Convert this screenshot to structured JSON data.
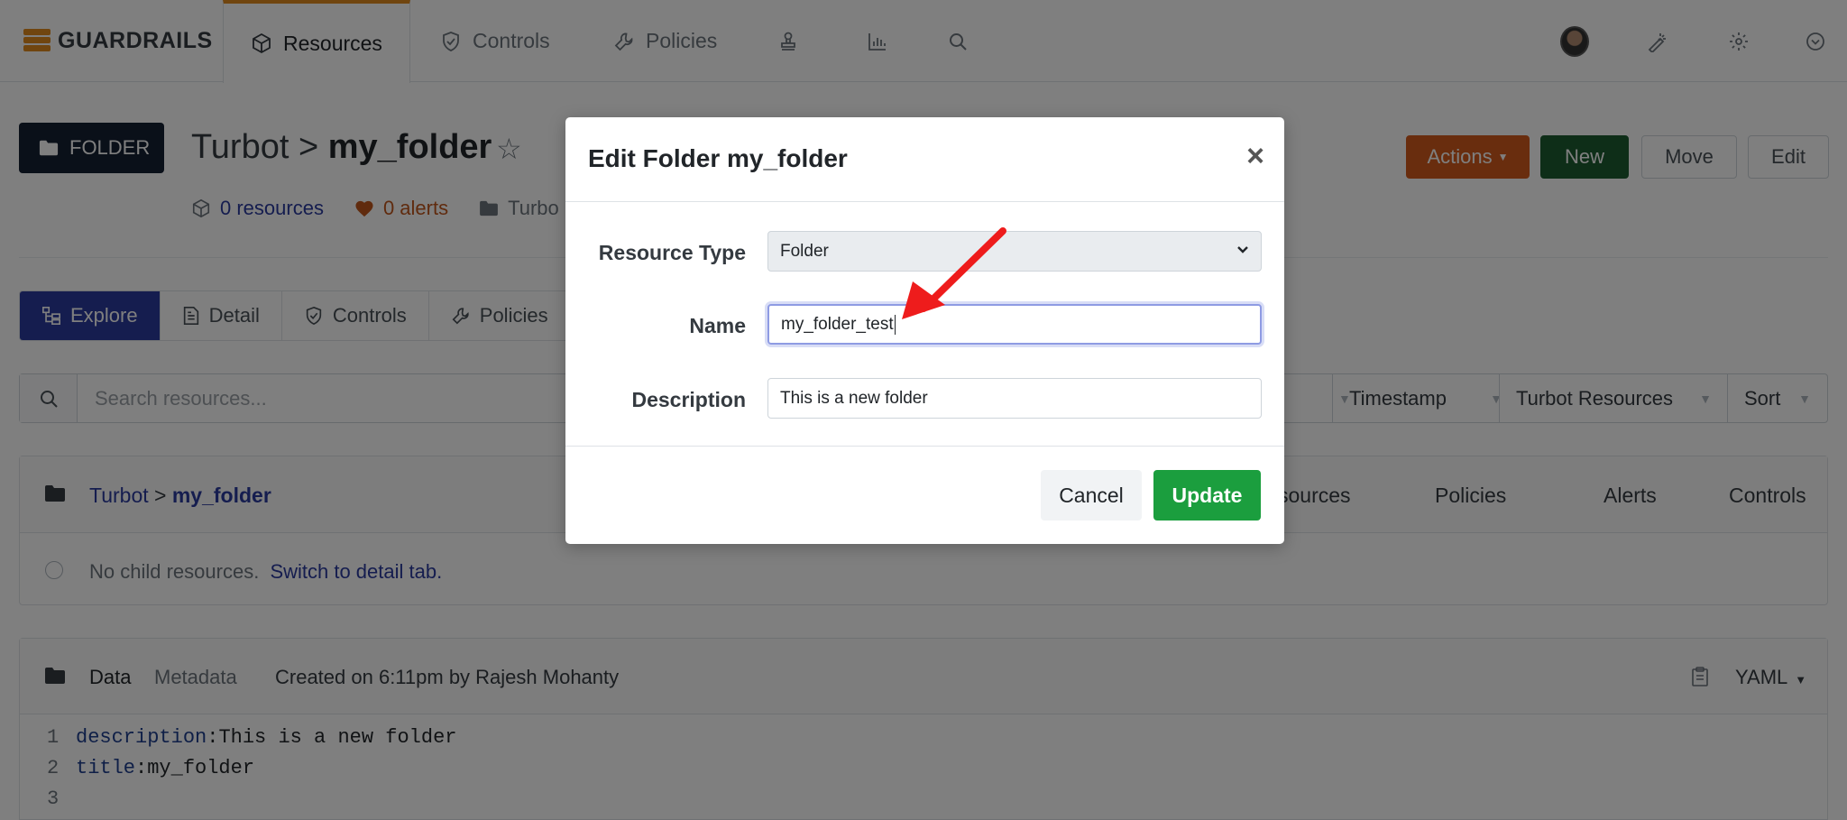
{
  "app": {
    "brand": "GUARDRAILS"
  },
  "topnav": {
    "tabs": [
      {
        "label": "Resources",
        "icon": "cube-icon"
      },
      {
        "label": "Controls",
        "icon": "shield-check-icon"
      },
      {
        "label": "Policies",
        "icon": "wrench-icon"
      }
    ],
    "icon_items": [
      "stamp-icon",
      "bar-chart-icon",
      "search-icon"
    ],
    "right_icons": [
      "avatar",
      "magic-wand-icon",
      "gear-icon",
      "chevron-circle-icon"
    ]
  },
  "header": {
    "type_badge": "FOLDER",
    "title_prefix": "Turbot > ",
    "title_name": "my_folder",
    "resources": "0 resources",
    "alerts": "0 alerts",
    "folder_path": "Turbo",
    "buttons": {
      "actions": "Actions",
      "new": "New",
      "move": "Move",
      "edit": "Edit"
    }
  },
  "subtabs": [
    "Explore",
    "Detail",
    "Controls",
    "Policies"
  ],
  "search": {
    "placeholder": "Search resources...",
    "filters": [
      "Timestamp",
      "Turbot Resources",
      "Sort"
    ]
  },
  "tree": {
    "crumb_root": "Turbot",
    "crumb_sep": " > ",
    "crumb_name": "my_folder",
    "columns": [
      "sources",
      "Policies",
      "Alerts",
      "Controls"
    ],
    "empty_text": "No child resources.",
    "empty_link": "Switch to detail tab."
  },
  "data_panel": {
    "tab_data": "Data",
    "tab_metadata": "Metadata",
    "created": "Created on 6:11pm by Rajesh Mohanty",
    "format": "YAML",
    "lines": [
      {
        "num": "1",
        "key": "description",
        "value": " This is a new folder"
      },
      {
        "num": "2",
        "key": "title",
        "value": " my_folder"
      },
      {
        "num": "3",
        "key": "",
        "value": ""
      }
    ]
  },
  "modal": {
    "title": "Edit Folder my_folder",
    "close": "×",
    "resource_type_label": "Resource Type",
    "resource_type_value": "Folder",
    "name_label": "Name",
    "name_value": "my_folder_test",
    "description_label": "Description",
    "description_value": "This is a new folder",
    "cancel": "Cancel",
    "update": "Update"
  },
  "colors": {
    "accent_orange": "#e08a1f",
    "actions_button": "#d35b1d",
    "new_button": "#1d5d30",
    "explore_active": "#2a3a9e",
    "update_button": "#1b9e3e",
    "annotation_arrow": "#ee1c1c"
  }
}
